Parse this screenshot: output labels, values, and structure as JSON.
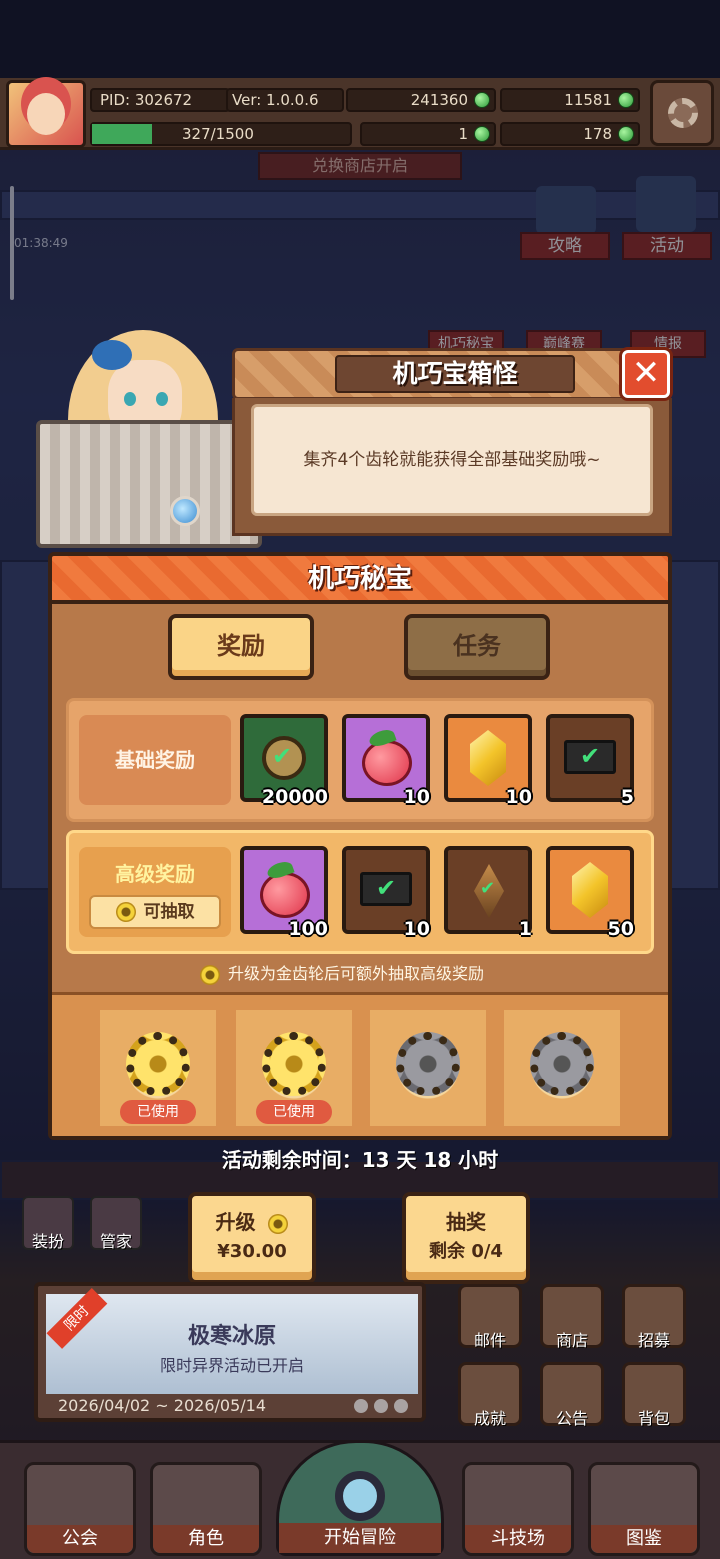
{
  "topbar": {
    "pid": "PID: 302672",
    "version": "Ver: 1.0.0.6",
    "gold": "241360",
    "gems": "11581",
    "exp": "327/1500",
    "clover": "1",
    "keys": "178"
  },
  "banner_top": "兑换商店开启",
  "left_timer": "01:38:49",
  "side_buttons": [
    "攻略",
    "活动",
    "机巧秘宝",
    "巅峰赛",
    "情报"
  ],
  "npc_dialog": {
    "title": "机巧宝箱怪",
    "text": "集齐4个齿轮就能获得全部基础奖励哦~",
    "close_symbol": "✕"
  },
  "panel": {
    "title": "机巧秘宝",
    "tabs": [
      "奖励",
      "任务"
    ],
    "basic": {
      "label": "基础奖励",
      "items": [
        {
          "icon": "gear-coin-icon",
          "qty": "20000"
        },
        {
          "icon": "fruit-icon",
          "qty": "10"
        },
        {
          "icon": "gold-crystal-icon",
          "qty": "10"
        },
        {
          "icon": "ticket-icon",
          "qty": "5"
        }
      ]
    },
    "advanced": {
      "label": "高级奖励",
      "can_draw": "可抽取",
      "items": [
        {
          "icon": "fruit-icon",
          "qty": "100"
        },
        {
          "icon": "ticket-icon",
          "qty": "10"
        },
        {
          "icon": "leaf-crystal-icon",
          "qty": "1"
        },
        {
          "icon": "gold-crystal-icon",
          "qty": "50"
        }
      ]
    },
    "note": "升级为金齿轮后可额外抽取高级奖励",
    "gears": [
      {
        "type": "gold",
        "status": "已使用"
      },
      {
        "type": "gold",
        "status": "已使用"
      },
      {
        "type": "grey",
        "status": ""
      },
      {
        "type": "grey",
        "status": ""
      }
    ]
  },
  "time_left": "活动剩余时间：13 天 18 小时",
  "upgrade_button": {
    "label": "升级",
    "price": "¥30.00"
  },
  "draw_button": {
    "label": "抽奖",
    "remaining": "剩余 0/4"
  },
  "small_buttons": [
    "装扮",
    "管家"
  ],
  "event": {
    "badge": "限时",
    "title": "极寒冰原",
    "subtitle": "限时异界活动已开启",
    "dates": "2026/04/02 ~ 2026/05/14"
  },
  "grid_buttons": [
    "邮件",
    "商店",
    "招募",
    "成就",
    "公告",
    "背包"
  ],
  "nav": [
    "公会",
    "角色",
    "开始冒险",
    "斗技场",
    "图鉴"
  ],
  "colors": {
    "panel_bg": "#b7794a",
    "header_orange": "#f07a3e",
    "active_tab": "#fad487",
    "check_green": "#42e07b"
  }
}
